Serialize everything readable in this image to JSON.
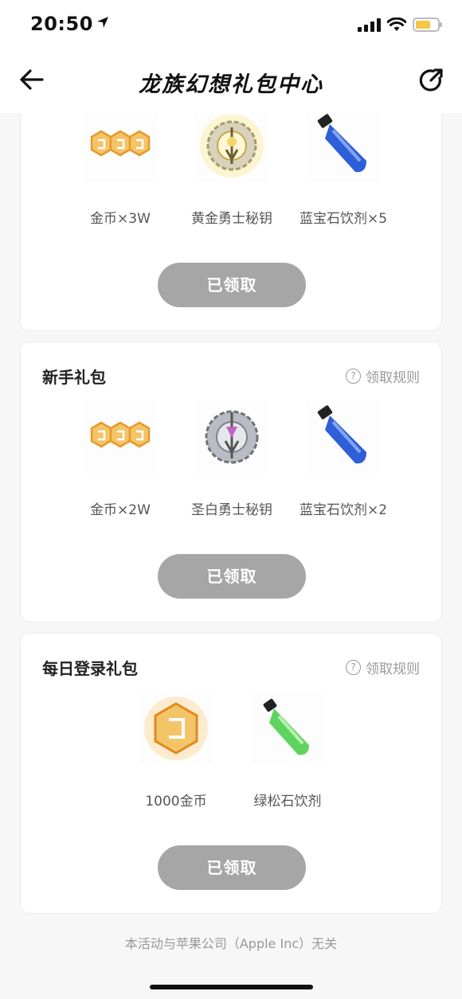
{
  "status_bar": {
    "time": "20:50"
  },
  "nav": {
    "title": "龙族幻想礼包中心"
  },
  "packs": [
    {
      "title": "",
      "items": [
        {
          "label": "金币×3W",
          "icon": "gold-coins-icon"
        },
        {
          "label": "黄金勇士秘钥",
          "icon": "gold-warrior-key-icon"
        },
        {
          "label": "蓝宝石饮剂×5",
          "icon": "blue-potion-icon"
        }
      ],
      "button_label": "已领取"
    },
    {
      "title": "新手礼包",
      "rule_label": "领取规则",
      "items": [
        {
          "label": "金币×2W",
          "icon": "gold-coins-icon"
        },
        {
          "label": "圣白勇士秘钥",
          "icon": "silver-warrior-key-icon"
        },
        {
          "label": "蓝宝石饮剂×2",
          "icon": "blue-potion-icon"
        }
      ],
      "button_label": "已领取"
    },
    {
      "title": "每日登录礼包",
      "rule_label": "领取规则",
      "items": [
        {
          "label": "1000金币",
          "icon": "gold-coin-icon"
        },
        {
          "label": "绿松石饮剂",
          "icon": "green-potion-icon"
        }
      ],
      "button_label": "已领取"
    }
  ],
  "footer": {
    "disclaimer": "本活动与苹果公司（Apple Inc）无关"
  },
  "colors": {
    "button_disabled": "#a6a6a6",
    "gold": "#f2b23a",
    "blue_potion": "#2f5fd8",
    "green_potion": "#5fd35f"
  }
}
